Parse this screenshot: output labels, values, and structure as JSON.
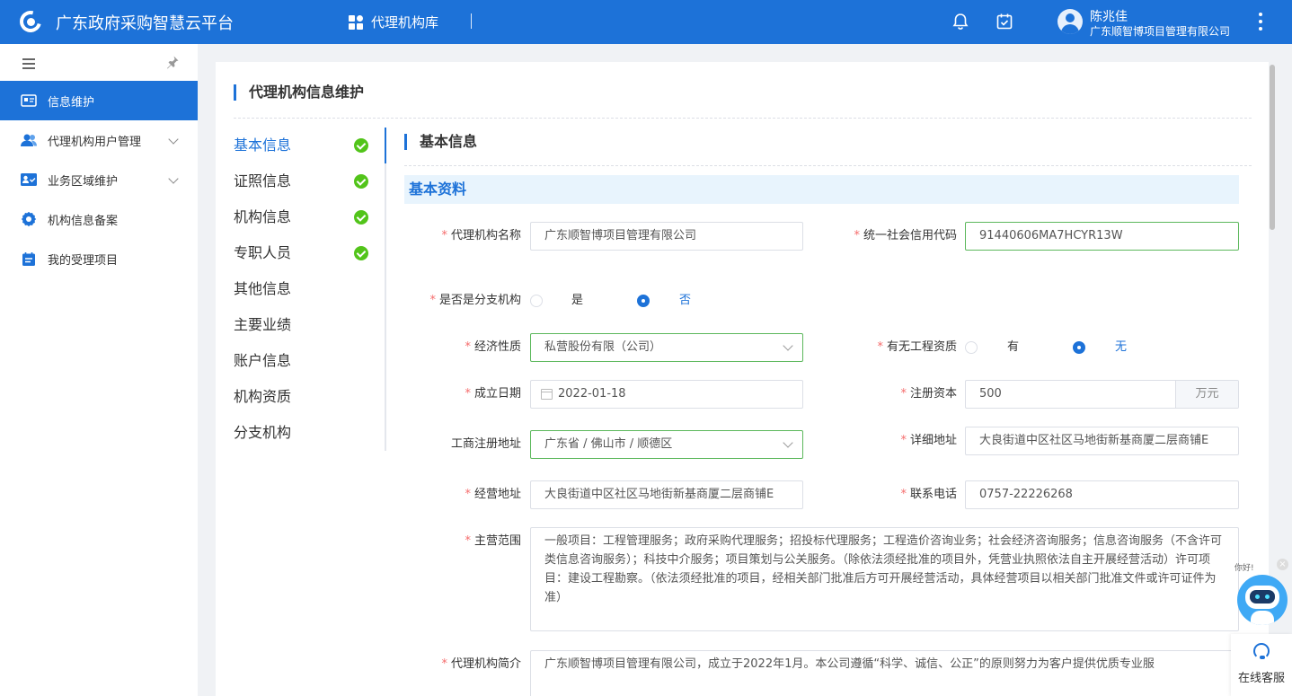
{
  "header": {
    "app_title": "广东政府采购智慧云平台",
    "module_label": "代理机构库",
    "user_name": "陈兆佳",
    "user_org": "广东顺智博项目管理有限公司",
    "brand_color": "#1d72d8"
  },
  "sidebar": {
    "items": [
      {
        "label": "信息维护",
        "icon": "id-card-icon",
        "active": true,
        "expandable": false
      },
      {
        "label": "代理机构用户管理",
        "icon": "users-icon",
        "active": false,
        "expandable": true
      },
      {
        "label": "业务区域维护",
        "icon": "user-check-card-icon",
        "active": false,
        "expandable": true
      },
      {
        "label": "机构信息备案",
        "icon": "gear-icon",
        "active": false,
        "expandable": false
      },
      {
        "label": "我的受理项目",
        "icon": "calendar-list-icon",
        "active": false,
        "expandable": false
      }
    ]
  },
  "main": {
    "title": "代理机构信息维护",
    "tabs": [
      {
        "label": "基本信息",
        "done": true,
        "active": true
      },
      {
        "label": "证照信息",
        "done": true,
        "active": false
      },
      {
        "label": "机构信息",
        "done": true,
        "active": false
      },
      {
        "label": "专职人员",
        "done": true,
        "active": false
      },
      {
        "label": "其他信息",
        "done": false,
        "active": false
      },
      {
        "label": "主要业绩",
        "done": false,
        "active": false
      },
      {
        "label": "账户信息",
        "done": false,
        "active": false
      },
      {
        "label": "机构资质",
        "done": false,
        "active": false
      },
      {
        "label": "分支机构",
        "done": false,
        "active": false
      }
    ],
    "section_title": "基本信息",
    "subsection_title": "基本资料",
    "form": {
      "agency_name": {
        "label": "代理机构名称",
        "value": "广东顺智博项目管理有限公司"
      },
      "credit_code": {
        "label": "统一社会信用代码",
        "value": "91440606MA7HCYR13W"
      },
      "is_branch": {
        "label": "是否是分支机构",
        "options": [
          "是",
          "否"
        ],
        "selected": "否"
      },
      "economic_nature": {
        "label": "经济性质",
        "value": "私营股份有限（公司）"
      },
      "has_qualification": {
        "label": "有无工程资质",
        "options": [
          "有",
          "无"
        ],
        "selected": "无"
      },
      "established_date": {
        "label": "成立日期",
        "value": "2022-01-18"
      },
      "registered_capital": {
        "label": "注册资本",
        "value": "500",
        "unit": "万元"
      },
      "registered_address": {
        "label": "工商注册地址",
        "value": "广东省 / 佛山市 / 顺德区"
      },
      "detail_address": {
        "label": "详细地址",
        "value": "大良街道中区社区马地街新基商厦二层商铺E"
      },
      "business_address": {
        "label": "经营地址",
        "value": "大良街道中区社区马地街新基商厦二层商铺E"
      },
      "phone": {
        "label": "联系电话",
        "value": "0757-22226268"
      },
      "business_scope": {
        "label": "主营范围",
        "value": "一般项目：工程管理服务；政府采购代理服务；招投标代理服务；工程造价咨询业务；社会经济咨询服务；信息咨询服务（不含许可类信息咨询服务）；科技中介服务；项目策划与公关服务。（除依法须经批准的项目外，凭营业执照依法自主开展经营活动）许可项目：建设工程勘察。（依法须经批准的项目，经相关部门批准后方可开展经营活动，具体经营项目以相关部门批准文件或许可证件为准）"
      },
      "intro": {
        "label": "代理机构简介",
        "value": "广东顺智博项目管理有限公司，成立于2022年1月。本公司遵循“科学、诚信、公正”的原则努力为客户提供优质专业服"
      }
    }
  },
  "chat": {
    "greeting": "你好!",
    "close_label": "×",
    "service_label": "在线客服"
  }
}
